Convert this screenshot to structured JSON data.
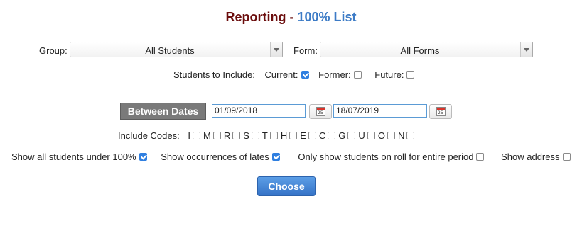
{
  "header": {
    "title_part1": "Reporting",
    "separator": "-",
    "title_part2": "100% List"
  },
  "filters": {
    "group_label": "Group:",
    "group_value": "All Students",
    "form_label": "Form:",
    "form_value": "All Forms"
  },
  "students_include": {
    "label": "Students to Include:",
    "options": [
      {
        "label": "Current:",
        "checked": true
      },
      {
        "label": "Former:",
        "checked": false
      },
      {
        "label": "Future:",
        "checked": false
      }
    ]
  },
  "dates": {
    "between_label": "Between Dates",
    "start_date": "01/09/2018",
    "end_date": "18/07/2019",
    "calendar_day": "25"
  },
  "include_codes": {
    "label": "Include Codes:",
    "codes": [
      "I",
      "M",
      "R",
      "S",
      "T",
      "H",
      "E",
      "C",
      "G",
      "U",
      "O",
      "N"
    ]
  },
  "options": [
    {
      "label": "Show all students under 100%",
      "checked": true
    },
    {
      "label": "Show occurrences of lates",
      "checked": true
    },
    {
      "label": "Only show students on roll for entire period",
      "checked": false
    },
    {
      "label": "Show address",
      "checked": false
    }
  ],
  "actions": {
    "choose_label": "Choose"
  },
  "colors": {
    "title_dark": "#6b0d0d",
    "title_accent": "#3c7bc6",
    "checkbox_checked": "#2f7fe0",
    "button_primary": "#3573c7",
    "button_secondary": "#7a7a7a"
  }
}
